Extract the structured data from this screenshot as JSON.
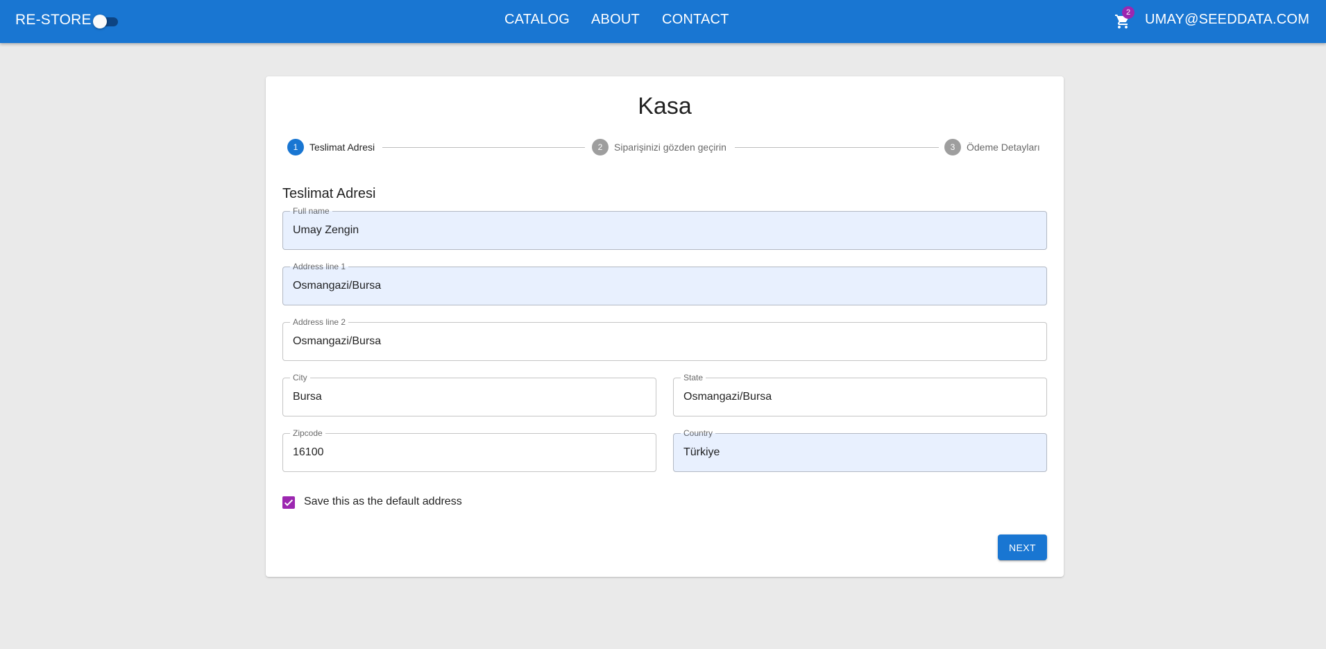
{
  "header": {
    "brand": "RE-STORE",
    "nav": {
      "catalog": "CATALOG",
      "about": "ABOUT",
      "contact": "CONTACT"
    },
    "cart_count": "2",
    "user_email": "UMAY@SEEDDATA.COM",
    "theme_toggle_on": false,
    "accent_color": "#1976d2"
  },
  "checkout": {
    "title": "Kasa",
    "steps": [
      {
        "number": "1",
        "label": "Teslimat Adresi",
        "active": true
      },
      {
        "number": "2",
        "label": "Siparişinizi gözden geçirin",
        "active": false
      },
      {
        "number": "3",
        "label": "Ödeme Detayları",
        "active": false
      }
    ],
    "section_title": "Teslimat Adresi",
    "fields": {
      "full_name": {
        "label": "Full name",
        "value": "Umay Zengin"
      },
      "address1": {
        "label": "Address line 1",
        "value": "Osmangazi/Bursa"
      },
      "address2": {
        "label": "Address line 2",
        "value": "Osmangazi/Bursa"
      },
      "city": {
        "label": "City",
        "value": "Bursa"
      },
      "state": {
        "label": "State",
        "value": "Osmangazi/Bursa"
      },
      "zipcode": {
        "label": "Zipcode",
        "value": "16100"
      },
      "country": {
        "label": "Country",
        "value": "Türkiye"
      }
    },
    "save_default": {
      "label": "Save this as the default address",
      "checked": true
    },
    "next_label": "NEXT"
  }
}
